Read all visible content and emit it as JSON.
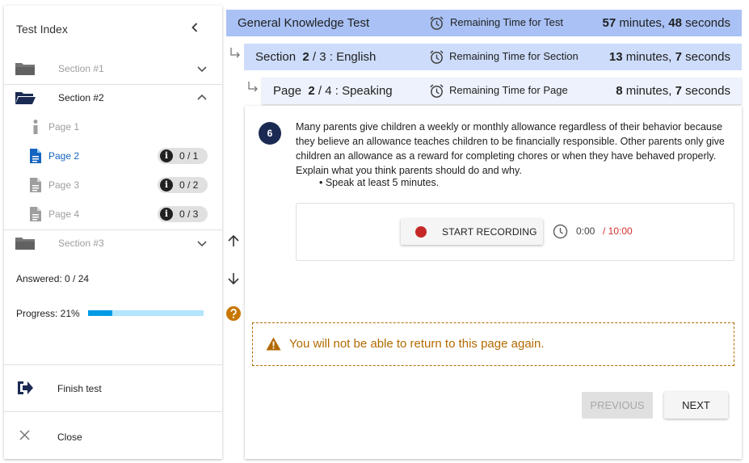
{
  "sidebar": {
    "title": "Test Index",
    "sections": [
      {
        "label": "Section #1",
        "icon": "folder-icon"
      },
      {
        "label": "Section #2",
        "icon": "folder-open-icon"
      },
      {
        "label": "Section #3",
        "icon": "folder-icon"
      }
    ],
    "pages": [
      {
        "label": "Page 1",
        "icon": "info-icon"
      },
      {
        "label": "Page 2",
        "icon": "document-icon",
        "badge": "0 / 1"
      },
      {
        "label": "Page 3",
        "icon": "document-icon",
        "badge": "0 / 2"
      },
      {
        "label": "Page 4",
        "icon": "document-icon",
        "badge": "0 / 3"
      }
    ],
    "answered": "Answered: 0 / 24",
    "progress_label": "Progress: 21%",
    "progress_value": 0.21,
    "finish_label": "Finish test",
    "close_label": "Close"
  },
  "header": {
    "test": {
      "name": "General Knowledge Test",
      "time_label": "Remaining Time for Test",
      "minutes": "57",
      "minutes_unit": "minutes,",
      "seconds": "48",
      "seconds_unit": "seconds"
    },
    "section": {
      "prefix": "Section",
      "current": "2",
      "total_suffix": "/ 3 : English",
      "time_label": "Remaining Time for Section",
      "minutes": "13",
      "minutes_unit": "minutes,",
      "seconds": "7",
      "seconds_unit": "seconds"
    },
    "page": {
      "prefix": "Page",
      "current": "2",
      "total_suffix": "/ 4 : Speaking",
      "time_label": "Remaining Time for Page",
      "minutes": "8",
      "minutes_unit": "minutes,",
      "seconds": "7",
      "seconds_unit": "seconds"
    }
  },
  "question": {
    "number": "6",
    "text": "Many parents give children a weekly or monthly allowance regardless of their behavior because they believe an allowance teaches children to be financially responsible. Other parents only give children an allowance as a reward for completing chores or when they have behaved properly. Explain what you think parents should do and why.",
    "bullet": "• Speak at least 5 minutes.",
    "record_label": "START RECORDING",
    "elapsed": "0:00",
    "limit": "/ 10:00"
  },
  "warning": "You will not be able to return to this page again.",
  "nav": {
    "previous": "PREVIOUS",
    "next": "NEXT"
  },
  "colors": {
    "test_bar": "#a9c1f5",
    "section_bar": "#cddcfa",
    "page_bar": "#edf2fc",
    "progress": "#039be5",
    "warning": "#b26a00",
    "accent": "#1565c0"
  }
}
